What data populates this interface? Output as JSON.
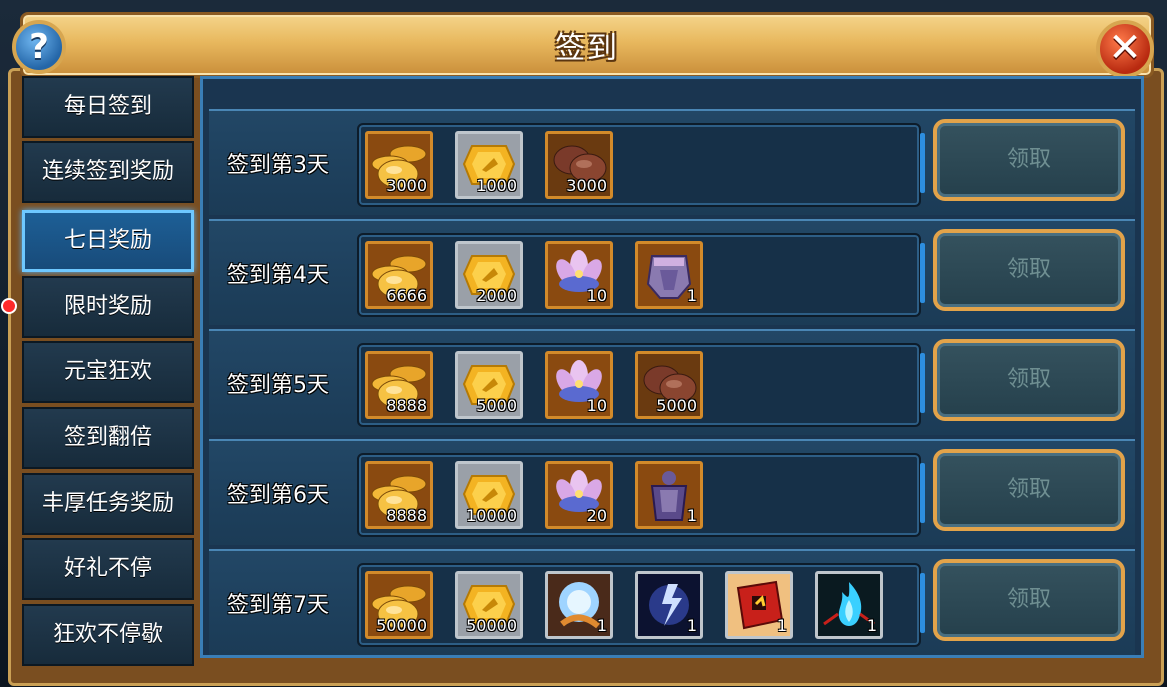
{
  "header": {
    "title": "签到",
    "help_glyph": "?",
    "close_glyph": "✕"
  },
  "sidebar": {
    "items": [
      {
        "label": "每日签到",
        "active": false
      },
      {
        "label": "连续签到奖励",
        "active": false
      },
      {
        "label": "七日奖励",
        "active": true
      },
      {
        "label": "限时奖励",
        "active": false
      },
      {
        "label": "元宝狂欢",
        "active": false
      },
      {
        "label": "签到翻倍",
        "active": false
      },
      {
        "label": "丰厚任务奖励",
        "active": false
      },
      {
        "label": "好礼不停",
        "active": false
      },
      {
        "label": "狂欢不停歇",
        "active": false
      }
    ]
  },
  "rows": [
    {
      "label": "签到第3天",
      "button": "领取",
      "items": [
        {
          "icon": "gold-coins-icon",
          "qty": "3000"
        },
        {
          "icon": "gold-ingot-icon",
          "qty": "1000"
        },
        {
          "icon": "mushroom-icon",
          "qty": "3000"
        }
      ]
    },
    {
      "label": "签到第4天",
      "button": "领取",
      "items": [
        {
          "icon": "gold-coins-icon",
          "qty": "6666"
        },
        {
          "icon": "gold-ingot-icon",
          "qty": "2000"
        },
        {
          "icon": "lotus-icon",
          "qty": "10"
        },
        {
          "icon": "armor-piece-icon",
          "qty": "1"
        }
      ]
    },
    {
      "label": "签到第5天",
      "button": "领取",
      "items": [
        {
          "icon": "gold-coins-icon",
          "qty": "8888"
        },
        {
          "icon": "gold-ingot-icon",
          "qty": "5000"
        },
        {
          "icon": "lotus-icon",
          "qty": "10"
        },
        {
          "icon": "mushroom-icon",
          "qty": "5000"
        }
      ]
    },
    {
      "label": "签到第6天",
      "button": "领取",
      "items": [
        {
          "icon": "gold-coins-icon",
          "qty": "8888"
        },
        {
          "icon": "gold-ingot-icon",
          "qty": "10000"
        },
        {
          "icon": "lotus-icon",
          "qty": "20"
        },
        {
          "icon": "armor-suit-icon",
          "qty": "1"
        }
      ]
    },
    {
      "label": "签到第7天",
      "button": "领取",
      "items": [
        {
          "icon": "gold-coins-icon",
          "qty": "50000"
        },
        {
          "icon": "gold-ingot-icon",
          "qty": "50000"
        },
        {
          "icon": "ice-orb-icon",
          "qty": "1"
        },
        {
          "icon": "lightning-orb-icon",
          "qty": "1"
        },
        {
          "icon": "red-scroll-icon",
          "qty": "1"
        },
        {
          "icon": "spirit-flame-icon",
          "qty": "1"
        }
      ]
    }
  ],
  "colors": {
    "accent_gold": "#e2a34a",
    "panel_blue": "#1a3550",
    "active_tab": "#1d5f96",
    "notification": "#ff2a2a"
  }
}
